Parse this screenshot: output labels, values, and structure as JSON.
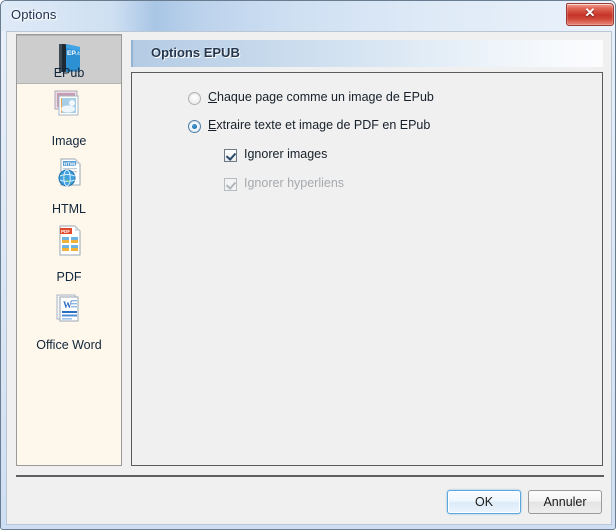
{
  "window": {
    "title": "Options",
    "close_label": "✕",
    "close_icon": "close-icon"
  },
  "sidebar": {
    "items": [
      {
        "label": "EPub",
        "icon": "epub-book-icon",
        "selected": true
      },
      {
        "label": "Image",
        "icon": "image-photos-icon",
        "selected": false
      },
      {
        "label": "HTML",
        "icon": "html-globe-icon",
        "selected": false
      },
      {
        "label": "PDF",
        "icon": "pdf-document-icon",
        "selected": false
      },
      {
        "label": "Office Word",
        "icon": "word-document-icon",
        "selected": false
      }
    ]
  },
  "content": {
    "header": "Options EPUB",
    "options": [
      {
        "type": "radio",
        "name": "page-as-image",
        "accel": "C",
        "label_rest": "haque page comme un image de EPub",
        "checked": false,
        "disabled": false
      },
      {
        "type": "radio",
        "name": "extract-text-and-image",
        "accel": "E",
        "label_rest": "xtraire texte et image de PDF en EPub",
        "checked": true,
        "disabled": false
      },
      {
        "type": "checkbox",
        "name": "ignore-images",
        "label": "Ignorer images",
        "checked": true,
        "disabled": false
      },
      {
        "type": "checkbox",
        "name": "ignore-hyperlinks",
        "label": "Ignorer hyperliens",
        "checked": true,
        "disabled": true
      }
    ]
  },
  "footer": {
    "ok_label": "OK",
    "cancel_label": "Annuler"
  },
  "colors": {
    "accent": "#1f6ea8",
    "title_text": "#1d3050",
    "close_red": "#c6342a",
    "sidebar_bg": "#fdf7ec",
    "selection": "#cdcdcd",
    "panel_bg": "#f0f0f0",
    "header_gradient_start": "#b4cbe4",
    "header_gradient_end": "#fbfcfe"
  }
}
